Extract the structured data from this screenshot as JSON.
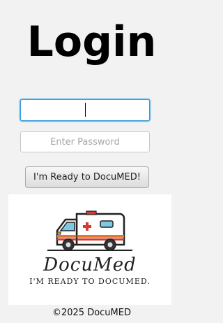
{
  "page": {
    "title": "Login"
  },
  "form": {
    "username_value": "",
    "password_placeholder": "Enter Password",
    "submit_label": "I'm Ready to DocuMED!"
  },
  "logo": {
    "brand": "DocuMed",
    "tagline": "I'm ready to DocuMed.",
    "icon": "ambulance-icon"
  },
  "footer": {
    "copyright": "©2025 DocuMED"
  }
}
